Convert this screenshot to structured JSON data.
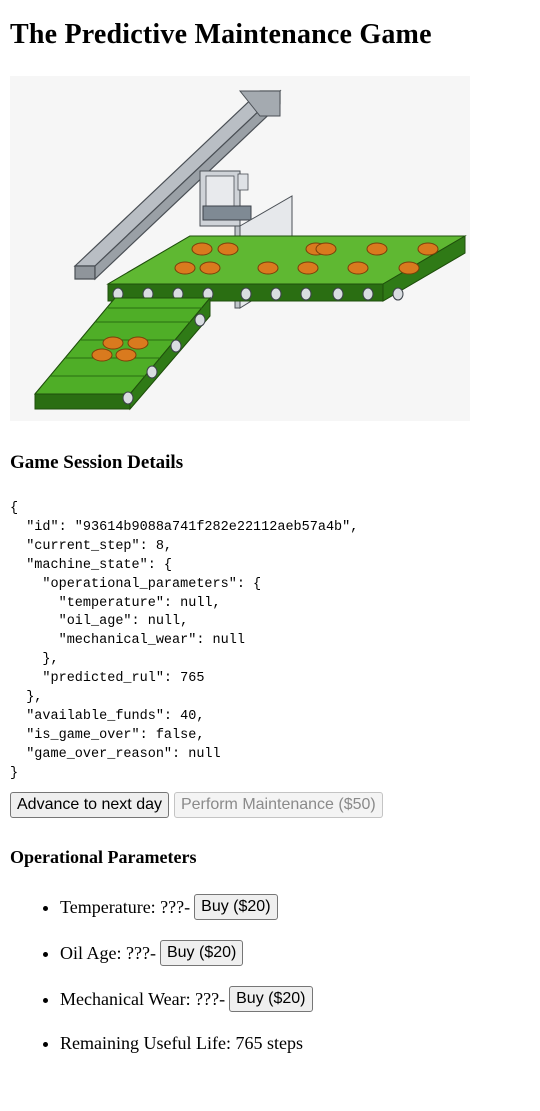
{
  "page": {
    "title": "The Predictive Maintenance Game"
  },
  "session": {
    "heading": "Game Session Details",
    "json_dump": "{\n  \"id\": \"93614b9088a741f282e22112aeb57a4b\",\n  \"current_step\": 8,\n  \"machine_state\": {\n    \"operational_parameters\": {\n      \"temperature\": null,\n      \"oil_age\": null,\n      \"mechanical_wear\": null\n    },\n    \"predicted_rul\": 765\n  },\n  \"available_funds\": 40,\n  \"is_game_over\": false,\n  \"game_over_reason\": null\n}"
  },
  "controls": {
    "advance_label": "Advance to next day",
    "maintenance_label": "Perform Maintenance ($50)",
    "maintenance_enabled": false
  },
  "parameters": {
    "heading": "Operational Parameters",
    "items": [
      {
        "label": "Temperature: ??? ",
        "separator": " - ",
        "buy_label": "Buy ($20)"
      },
      {
        "label": "Oil Age: ??? ",
        "separator": " - ",
        "buy_label": "Buy ($20)"
      },
      {
        "label": "Mechanical Wear: ??? ",
        "separator": " - ",
        "buy_label": "Buy ($20)"
      },
      {
        "label": "Remaining Useful Life: 765 steps"
      }
    ]
  },
  "colors": {
    "belt_green": "#3f9a1f",
    "belt_dark": "#2a6e12",
    "product_orange": "#d97a1e",
    "rail_gray": "#b9bec4"
  }
}
